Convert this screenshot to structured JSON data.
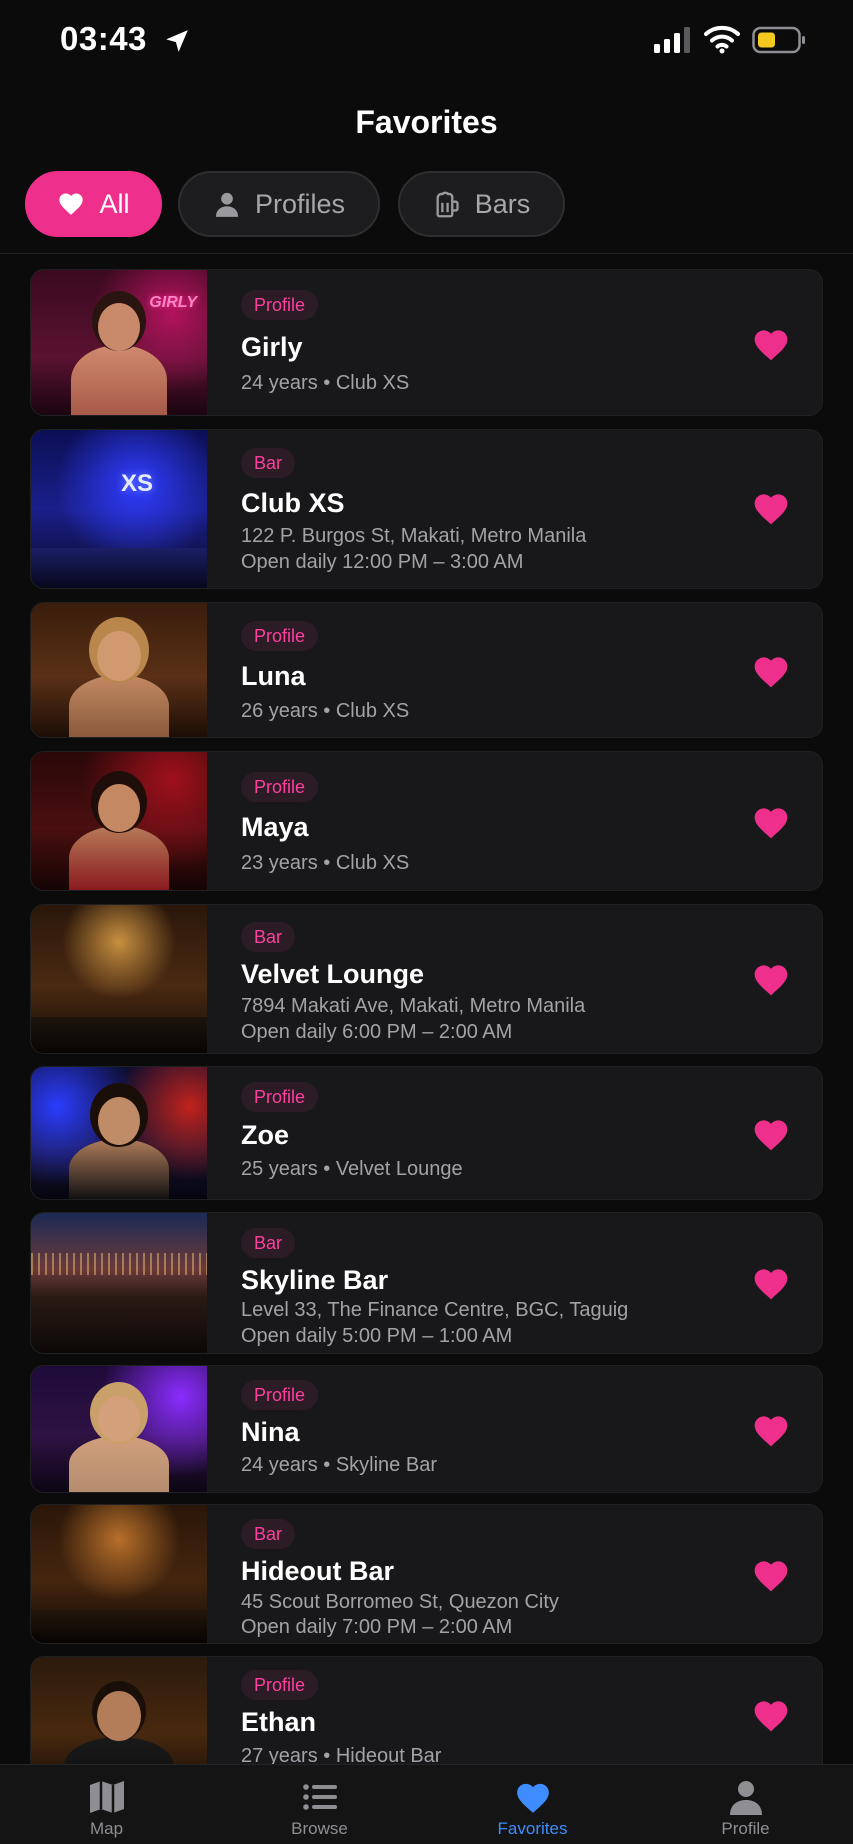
{
  "status_bar": {
    "time": "03:43"
  },
  "header": {
    "title": "Favorites"
  },
  "filters": [
    {
      "label": "All",
      "icon": "heart-icon",
      "active": true
    },
    {
      "label": "Profiles",
      "icon": "person-icon",
      "active": false
    },
    {
      "label": "Bars",
      "icon": "beer-mug-icon",
      "active": false
    }
  ],
  "favorites": [
    {
      "type": "Profile",
      "name": "Girly",
      "meta1": "24 years • Club XS",
      "meta2": "",
      "thumb_sign": "GIRLY"
    },
    {
      "type": "Bar",
      "name": "Club XS",
      "meta1": "122 P. Burgos St, Makati, Metro Manila",
      "meta2": "Open daily 12:00 PM – 3:00 AM",
      "thumb_sign": "XS"
    },
    {
      "type": "Profile",
      "name": "Luna",
      "meta1": "26 years • Club XS",
      "meta2": ""
    },
    {
      "type": "Profile",
      "name": "Maya",
      "meta1": "23 years • Club XS",
      "meta2": ""
    },
    {
      "type": "Bar",
      "name": "Velvet Lounge",
      "meta1": "7894 Makati Ave, Makati, Metro Manila",
      "meta2": "Open daily 6:00 PM – 2:00 AM"
    },
    {
      "type": "Profile",
      "name": "Zoe",
      "meta1": "25 years • Velvet Lounge",
      "meta2": ""
    },
    {
      "type": "Bar",
      "name": "Skyline Bar",
      "meta1": "Level 33, The Finance Centre, BGC, Taguig",
      "meta2": "Open daily 5:00 PM – 1:00 AM"
    },
    {
      "type": "Profile",
      "name": "Nina",
      "meta1": "24 years • Skyline Bar",
      "meta2": ""
    },
    {
      "type": "Bar",
      "name": "Hideout Bar",
      "meta1": "45 Scout Borromeo St, Quezon City",
      "meta2": "Open daily 7:00 PM – 2:00 AM"
    },
    {
      "type": "Profile",
      "name": "Ethan",
      "meta1": "27 years • Hideout Bar",
      "meta2": ""
    }
  ],
  "tabs": [
    {
      "label": "Map",
      "icon": "map-icon",
      "active": false
    },
    {
      "label": "Browse",
      "icon": "list-icon",
      "active": false
    },
    {
      "label": "Favorites",
      "icon": "heart-icon",
      "active": true
    },
    {
      "label": "Profile",
      "icon": "person-icon",
      "active": false
    }
  ],
  "colors": {
    "accent": "#ee2f8c",
    "active_tab": "#3f8cff",
    "background": "#0b0b0c",
    "card": "#18181a"
  }
}
